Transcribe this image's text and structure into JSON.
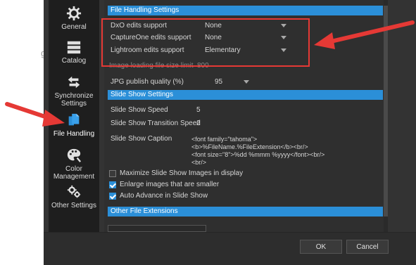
{
  "left_ghost_text": "g",
  "sidebar": {
    "items": [
      {
        "label": "General",
        "icon": "gear-icon"
      },
      {
        "label": "Catalog",
        "icon": "catalog-icon"
      },
      {
        "label": "Synchronize\nSettings",
        "label1": "Synchronize",
        "label2": "Settings",
        "icon": "sync-icon"
      },
      {
        "label": "File Handling",
        "icon": "file-handling-icon"
      },
      {
        "label1": "Color",
        "label2": "Management",
        "icon": "palette-icon"
      },
      {
        "label": "Other Settings",
        "icon": "other-settings-icon"
      }
    ]
  },
  "sections": {
    "file_handling": "File Handling Settings",
    "slide_show": "Slide Show Settings",
    "other_ext": "Other File Extensions"
  },
  "file_handling": {
    "dxo_label": "DxO edits support",
    "dxo_value": "None",
    "captureone_label": "CaptureOne edits support",
    "captureone_value": "None",
    "lightroom_label": "Lightroom edits support",
    "lightroom_value": "Elementary",
    "image_limit_label": "Image loading file size limit",
    "image_limit_value": "800",
    "jpg_label": "JPG publish quality (%)",
    "jpg_value": "95"
  },
  "slide_show": {
    "speed_label": "Slide Show Speed",
    "speed_value": "5",
    "transition_label": "Slide Show Transition Speed",
    "transition_value": "2",
    "caption_label": "Slide Show Caption",
    "caption_line1": "<font family=\"tahoma\">",
    "caption_line2": "<b>%FileName.%FileExtension</b><br/>",
    "caption_line3": "<font size=\"8\">%dd %mmm %yyyy</font><br/>",
    "caption_line4": "<br/>",
    "maximize_label": "Maximize Slide Show Images in display",
    "maximize_checked": false,
    "enlarge_label": "Enlarge images that are smaller",
    "enlarge_checked": true,
    "auto_advance_label": "Auto Advance in Slide Show",
    "auto_advance_checked": true
  },
  "footer": {
    "ok_label": "OK",
    "cancel_label": "Cancel"
  },
  "colors": {
    "accent": "#2b8fd8",
    "annotation": "#e53935",
    "sidebar_bg": "#1e1e1e",
    "panel_bg": "#2f2f2f"
  }
}
